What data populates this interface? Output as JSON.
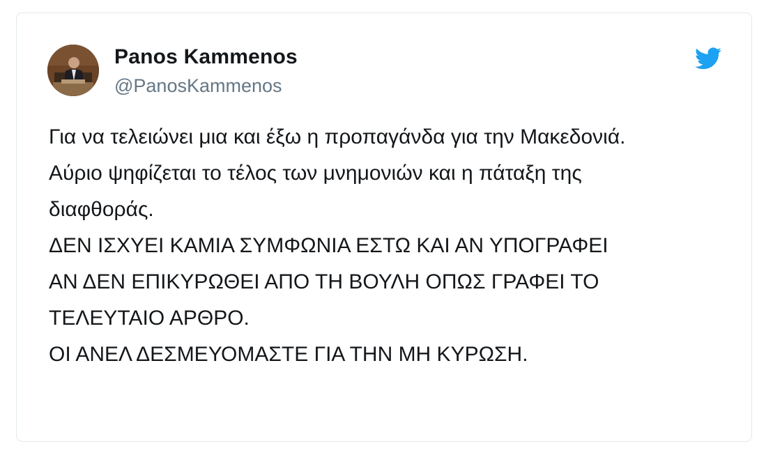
{
  "tweet": {
    "author": {
      "name": "Panos Kammenos",
      "handle": "@PanosKammenos"
    },
    "text_lines": [
      "Για να τελειώνει μια και έξω η προπαγάνδα για την Μακεδονιά.",
      "Αύριο ψηφίζεται το τέλος των μνημονιών και η πάταξη της",
      "διαφθοράς.",
      "ΔΕΝ ΙΣΧΥΕΙ ΚΑΜΙΑ ΣΥΜΦΩΝΙΑ ΕΣΤΩ ΚΑΙ ΑΝ ΥΠΟΓΡΑΦΕΙ",
      "ΑΝ ΔΕΝ ΕΠΙΚΥΡΩΘΕΙ ΑΠΟ ΤΗ ΒΟΥΛΗ ΟΠΩΣ ΓΡΑΦΕΙ ΤΟ",
      "ΤΕΛΕΥΤΑΙΟ ΑΡΘΡΟ.",
      "ΟΙ ΑΝΕΛ ΔΕΣΜΕΥΟΜΑΣΤΕ ΓΙΑ ΤΗΝ ΜΗ ΚΥΡΩΣΗ."
    ]
  },
  "icons": {
    "brand_logo": "twitter-bird-icon"
  },
  "colors": {
    "brand": "#1da1f2",
    "text": "#14171a",
    "secondary_text": "#657786",
    "border": "#e1e8ed"
  }
}
